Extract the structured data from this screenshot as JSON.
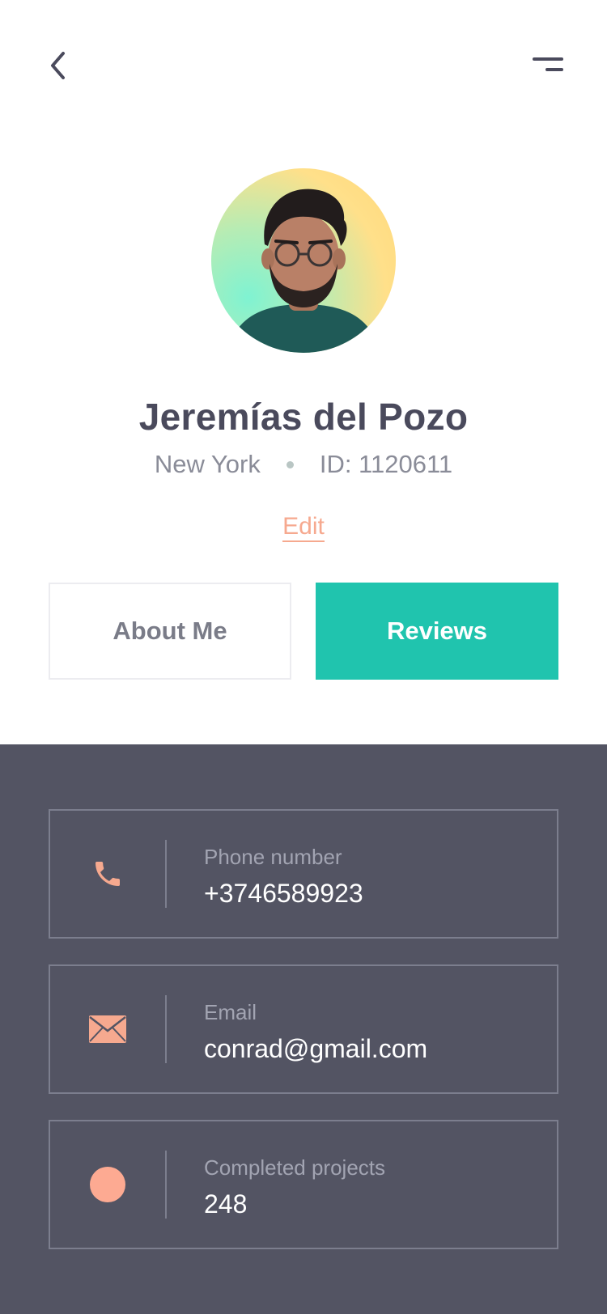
{
  "header": {
    "back_icon": "chevron-left-icon",
    "menu_icon": "menu-icon"
  },
  "profile": {
    "name": "Jeremías del Pozo",
    "location": "New York",
    "id_text": "ID: 1120611",
    "edit_label": "Edit"
  },
  "tabs": [
    {
      "label": "About Me",
      "active": false
    },
    {
      "label": "Reviews",
      "active": true
    }
  ],
  "contact": [
    {
      "icon": "phone-icon",
      "label": "Phone number",
      "value": "+3746589923"
    },
    {
      "icon": "mail-icon",
      "label": "Email",
      "value": "conrad@gmail.com"
    },
    {
      "icon": "circle-icon",
      "label": "Completed projects",
      "value": "248"
    }
  ],
  "colors": {
    "accent": "#20c4ae",
    "highlight": "#f6a98f",
    "dark_panel": "#535463",
    "text_dark": "#4a4a5c"
  }
}
